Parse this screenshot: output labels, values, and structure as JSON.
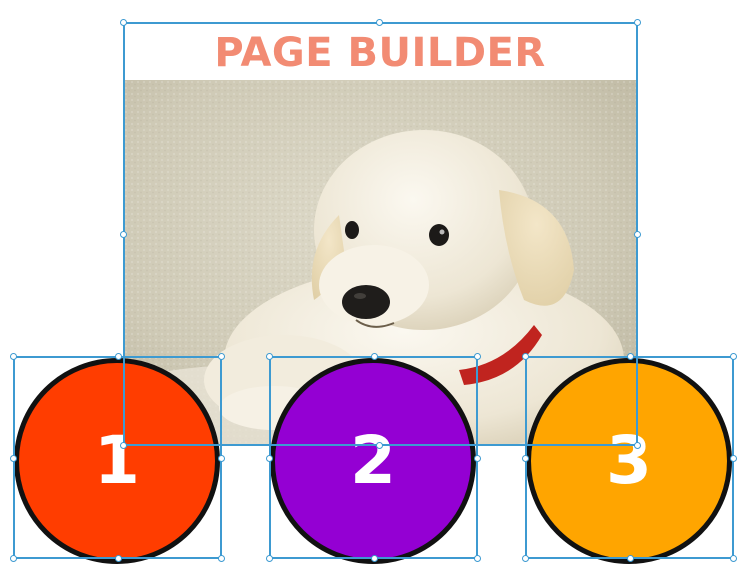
{
  "page": {
    "title": "PAGE BUILDER"
  },
  "image": {
    "subject": "white-puppy-photo"
  },
  "circles": [
    {
      "label": "1",
      "color": "#ff3d00"
    },
    {
      "label": "2",
      "color": "#9400d3"
    },
    {
      "label": "3",
      "color": "#ffa500"
    }
  ],
  "colors": {
    "selection": "#3d9ad1",
    "title": "#f28b73"
  }
}
